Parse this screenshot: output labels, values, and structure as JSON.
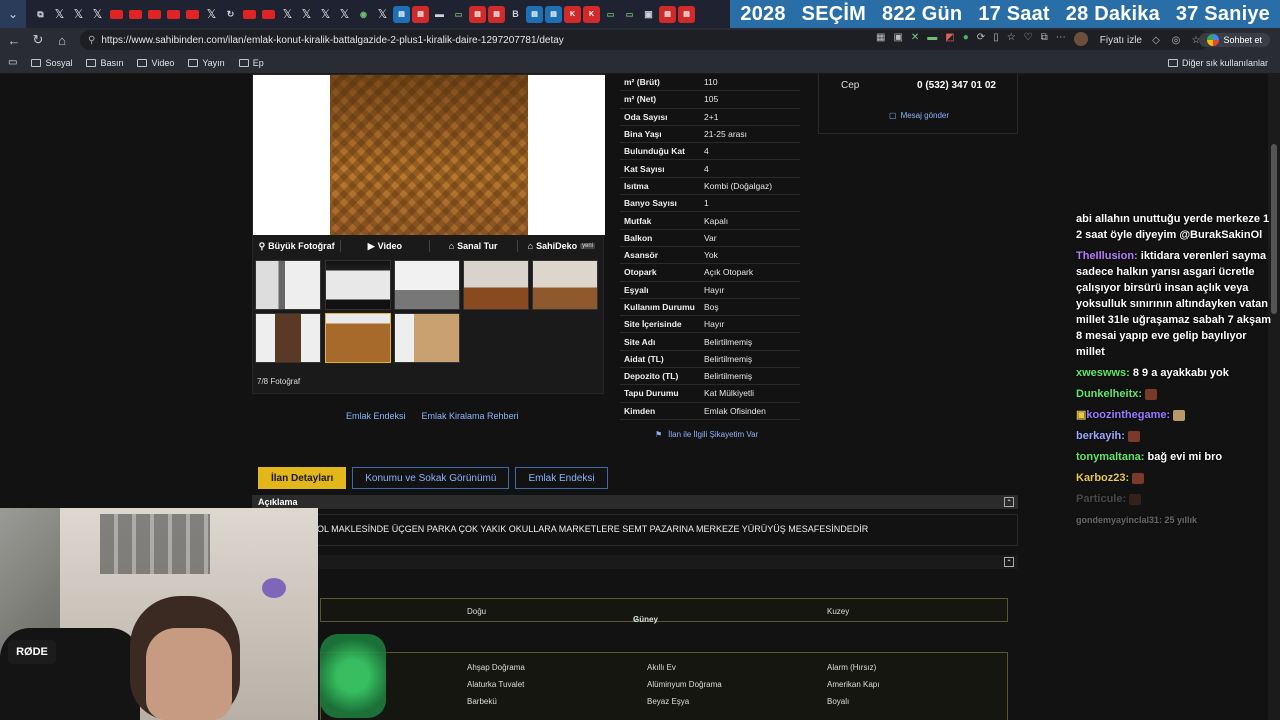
{
  "browser": {
    "countdown": {
      "year": "2028",
      "event": "SEÇİM",
      "days": "822 Gün",
      "hours": "17 Saat",
      "minutes": "28 Dakika",
      "seconds": "37 Saniye"
    },
    "url": "https://www.sahibinden.com/ilan/emlak-konut-kiralik-battalgazide-2-plus1-kiralik-daire-1297207781/detay",
    "watch_price": "Fiyatı izle",
    "chat_button": "Sohbet et",
    "bookmarks": [
      "Sosyal",
      "Basın",
      "Video",
      "Yayın",
      "Ep"
    ],
    "other_bookmarks": "Diğer sık kullanılanlar"
  },
  "gallery": {
    "tools": [
      "Büyük Fotoğraf",
      "Video",
      "Sanal Tur",
      "SahiDeko"
    ],
    "new_badge": "yeni",
    "photo_count": "7/8 Fotoğraf",
    "links": [
      "Emlak Endeksi",
      "Emlak Kiralama Rehberi"
    ]
  },
  "info": [
    {
      "k": "m² (Brüt)",
      "v": "110"
    },
    {
      "k": "m² (Net)",
      "v": "105"
    },
    {
      "k": "Oda Sayısı",
      "v": "2+1"
    },
    {
      "k": "Bina Yaşı",
      "v": "21-25 arası"
    },
    {
      "k": "Bulunduğu Kat",
      "v": "4"
    },
    {
      "k": "Kat Sayısı",
      "v": "4"
    },
    {
      "k": "Isıtma",
      "v": "Kombi (Doğalgaz)"
    },
    {
      "k": "Banyo Sayısı",
      "v": "1"
    },
    {
      "k": "Mutfak",
      "v": "Kapalı"
    },
    {
      "k": "Balkon",
      "v": "Var"
    },
    {
      "k": "Asansör",
      "v": "Yok"
    },
    {
      "k": "Otopark",
      "v": "Açık Otopark"
    },
    {
      "k": "Eşyalı",
      "v": "Hayır"
    },
    {
      "k": "Kullanım Durumu",
      "v": "Boş"
    },
    {
      "k": "Site İçerisinde",
      "v": "Hayır"
    },
    {
      "k": "Site Adı",
      "v": "Belirtilmemiş"
    },
    {
      "k": "Aidat (TL)",
      "v": "Belirtilmemiş"
    },
    {
      "k": "Depozito (TL)",
      "v": "Belirtilmemiş"
    },
    {
      "k": "Tapu Durumu",
      "v": "Kat Mülkiyetli"
    },
    {
      "k": "Kimden",
      "v": "Emlak Ofisinden"
    }
  ],
  "complaint": "İlan ile İlgili Şikayetim Var",
  "contact": {
    "label": "Cep",
    "number": "0 (532) 347 01 02",
    "message": "Mesaj gönder"
  },
  "tabs": [
    "İlan Detayları",
    "Konumu ve Sokak Görünümü",
    "Emlak Endeksi"
  ],
  "description": {
    "title": "Açıklama",
    "text": "OL MAKLESİNDE ÜÇGEN PARKA ÇOK YAKIK OKULLARA MARKETLERE SEMT PAZARINA MERKEZE YÜRÜYÜŞ MESAFESİNDEDİR"
  },
  "facade": [
    "Doğu",
    "Güney",
    "Kuzey"
  ],
  "features": [
    [
      "Ahşap Doğrama",
      "Akıllı Ev",
      "Alarm (Hırsız)"
    ],
    [
      "Alaturka Tuvalet",
      "Alüminyum Doğrama",
      "Amerikan Kapı"
    ],
    [
      "Barbekü",
      "Beyaz Eşya",
      "Boyalı"
    ]
  ],
  "chat": [
    {
      "user": "",
      "text": "abi allahın unuttuğu yerde merkeze 1 2 saat öyle diyeyim @BurakSakinOl"
    },
    {
      "user": "TheIllusion:",
      "text": "iktidara verenleri sayma sadece halkın yarısı asgari ücretle çalışıyor birsürü insan açlık veya yoksulluk sınırının altındayken vatan millet 31le uğraşamaz sabah 7 akşam 8 mesai yapıp eve gelip bayılıyor millet"
    },
    {
      "user": "xweswws:",
      "text": "8 9 a ayakkabı yok"
    },
    {
      "user": "Dunkelheitx:",
      "text": ""
    },
    {
      "user": "koozinthegame:",
      "text": ""
    },
    {
      "user": "berkayih:",
      "text": ""
    },
    {
      "user": "tonymaltana:",
      "text": "bağ evi mi bro"
    },
    {
      "user": "Karboz23:",
      "text": ""
    },
    {
      "user": "Particule:",
      "text": ""
    },
    {
      "user": "",
      "text": "gondemyayinclal31: 25 yıllık"
    }
  ],
  "webcam": {
    "mic_brand": "RØDE"
  },
  "colors": {
    "accent_tab": "#e3b61c",
    "link": "#8ab4f8",
    "countdown_bg": "#2a6ea8"
  }
}
